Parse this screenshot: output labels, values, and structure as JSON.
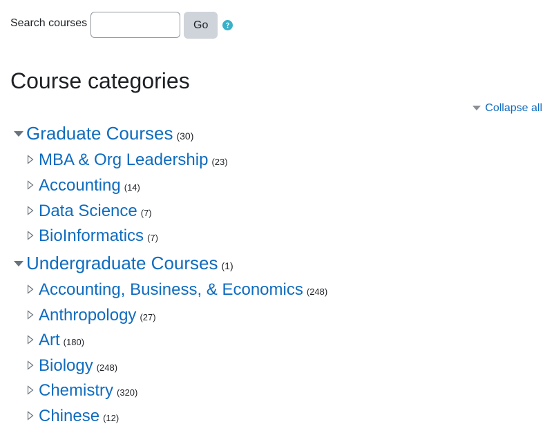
{
  "search": {
    "label": "Search courses",
    "input_value": "",
    "go_label": "Go",
    "help_icon": "help-circle-icon"
  },
  "page_title": "Course categories",
  "collapse_all_label": "Collapse all",
  "categories": [
    {
      "name": "Graduate Courses",
      "count": "(30)",
      "expanded": true,
      "children": [
        {
          "name": "MBA & Org Leadership",
          "count": "(23)"
        },
        {
          "name": "Accounting",
          "count": "(14)"
        },
        {
          "name": "Data Science",
          "count": "(7)"
        },
        {
          "name": "BioInformatics",
          "count": "(7)"
        }
      ]
    },
    {
      "name": "Undergraduate Courses",
      "count": "(1)",
      "expanded": true,
      "children": [
        {
          "name": "Accounting, Business, & Economics",
          "count": "(248)"
        },
        {
          "name": "Anthropology",
          "count": "(27)"
        },
        {
          "name": "Art",
          "count": "(180)"
        },
        {
          "name": "Biology",
          "count": "(248)"
        },
        {
          "name": "Chemistry",
          "count": "(320)"
        },
        {
          "name": "Chinese",
          "count": "(12)"
        }
      ]
    }
  ],
  "colors": {
    "link": "#0f6cbf",
    "text": "#1d2125",
    "button_bg": "#ced4da",
    "help": "#3bb1c9",
    "toggle": "#6a737b"
  }
}
